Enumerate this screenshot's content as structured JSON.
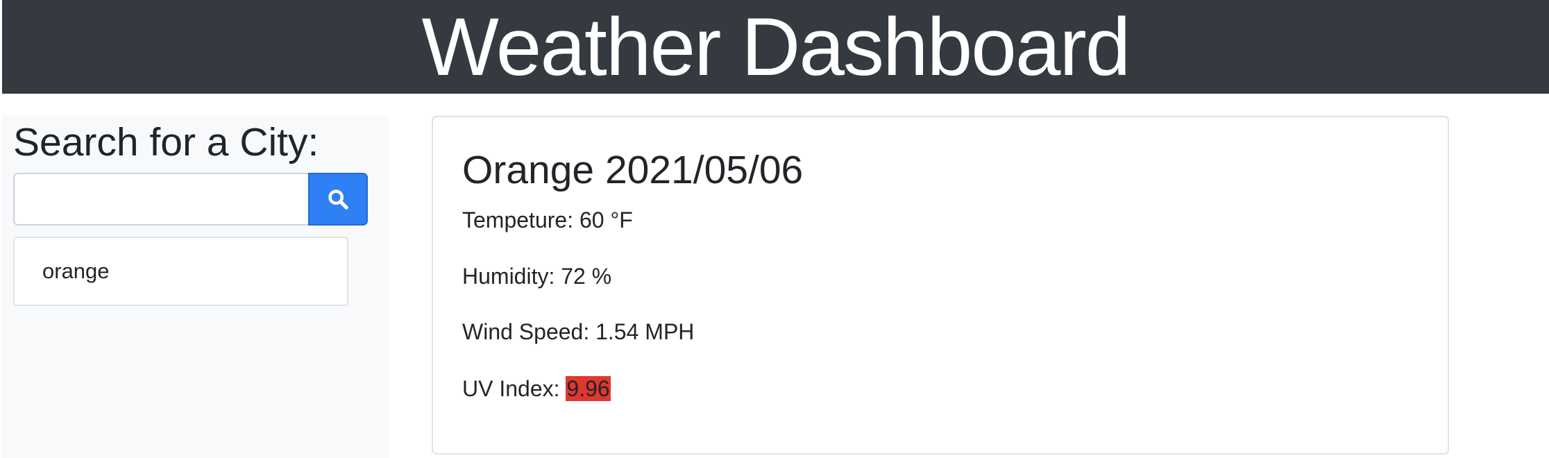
{
  "header": {
    "title": "Weather Dashboard"
  },
  "sidebar": {
    "title": "Search for a City:",
    "search": {
      "value": "",
      "placeholder": ""
    },
    "search_button_icon": "search-icon",
    "history": [
      {
        "label": "orange"
      }
    ]
  },
  "current": {
    "title": "Orange 2021/05/06",
    "temperature_label": "Tempeture: 60 °F",
    "humidity_label": "Humidity: 72 %",
    "wind_label": "Wind Speed: 1.54 MPH",
    "uv_label": "UV Index:",
    "uv_value": "9.96"
  },
  "colors": {
    "header_bg": "#343a40",
    "accent": "#2f7ff5",
    "uv_severe": "#e0372f",
    "sidebar_bg": "#f8f9fa"
  }
}
